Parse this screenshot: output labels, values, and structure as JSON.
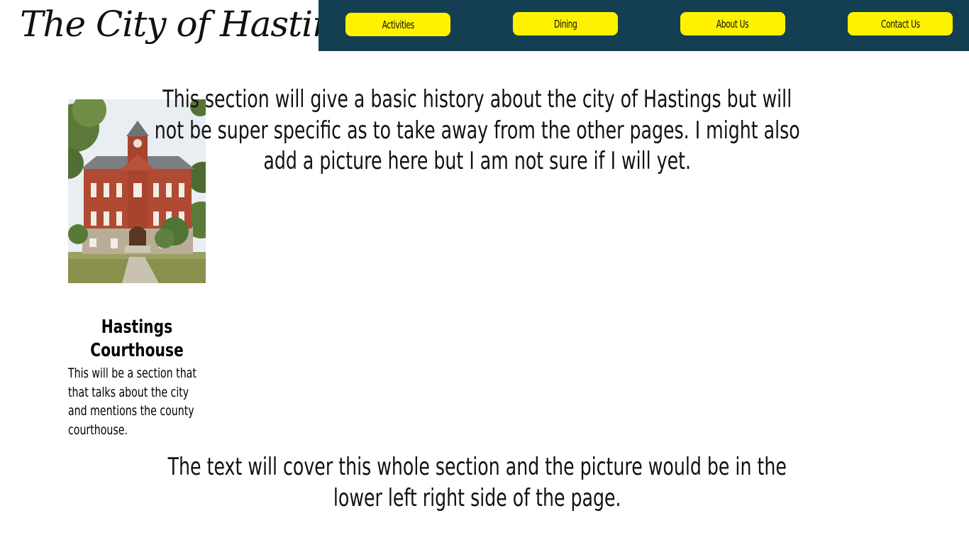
{
  "header": {
    "logo_text": "The City of Hastings",
    "nav": [
      {
        "label": "Activities"
      },
      {
        "label": "Dining"
      },
      {
        "label": "About Us"
      },
      {
        "label": "Contact Us"
      }
    ]
  },
  "sidebar": {
    "image_alt": "Hastings Courthouse",
    "caption_title_line1": "Hastings",
    "caption_title_line2": "Courthouse",
    "caption_text": "This will be a section that that talks about the city and mentions the county courthouse."
  },
  "main": {
    "intro": "This section will give a basic history about the city of Hastings but will not be super specific as to take away from the other pages. I might also add a picture here but I am not sure if I will yet.",
    "footer_note": "The text will cover this whole section and the picture would be in the lower left right side of the page."
  },
  "colors": {
    "nav_background": "#143f52",
    "nav_button": "#fff200",
    "page_background": "#ffffff"
  }
}
